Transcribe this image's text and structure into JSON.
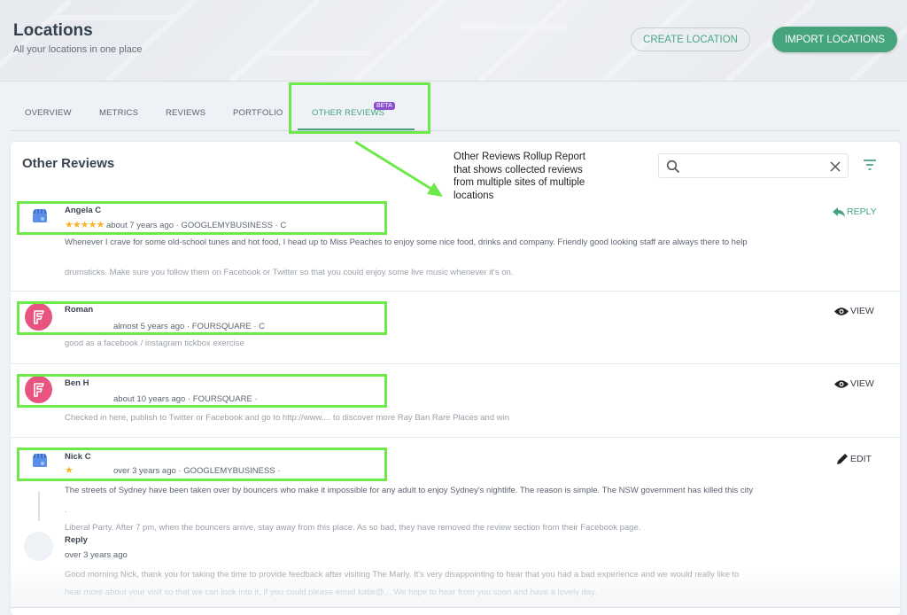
{
  "header": {
    "title": "Locations",
    "subtitle": "All your locations in one place",
    "create_button": "CREATE LOCATION",
    "import_button": "IMPORT LOCATIONS"
  },
  "tabs": [
    {
      "label": "OVERVIEW",
      "active": false
    },
    {
      "label": "METRICS",
      "active": false
    },
    {
      "label": "REVIEWS",
      "active": false
    },
    {
      "label": "PORTFOLIO",
      "active": false
    },
    {
      "label": "OTHER REVIEWS",
      "active": true,
      "badge": "BETA"
    }
  ],
  "colors": {
    "accent": "#45a47c",
    "beta_badge": "#8a4fd1",
    "star": "#f5b52b",
    "foursquare": "#e75480",
    "gmb": "#4a7fd9",
    "annotation_highlight": "#6ee94a"
  },
  "panel": {
    "title": "Other Reviews",
    "search_placeholder": "",
    "search_icon": "search-icon",
    "clear_icon": "close-icon",
    "filter_icon": "filter-icon"
  },
  "annotation": {
    "text": "Other Reviews Rollup Report that shows collected reviews from multiple sites of multiple locations"
  },
  "reviews": [
    {
      "author": "Angela C",
      "source_icon": "google-my-business-icon",
      "rating": 5,
      "stars": "★★★★★",
      "meta": "about 7 years ago · GOOGLEMYBUSINESS · C",
      "action": "REPLY",
      "action_icon": "reply-icon",
      "text_lines": [
        "Whenever I crave for some old-school tunes and hot food, I head up to Miss Peaches to enjoy some nice food, drinks and company. Friendly good looking staff are always there to help",
        "drumsticks. Make sure you follow them on Facebook or Twitter so that you could enjoy some live music whenever it's on."
      ]
    },
    {
      "author": "Roman",
      "source_icon": "foursquare-icon",
      "meta": "almost 5 years ago · FOURSQUARE · C",
      "action": "VIEW",
      "action_icon": "eye-icon",
      "text_lines": [
        "good as a facebook / instagram tickbox exercise"
      ]
    },
    {
      "author": "Ben H",
      "source_icon": "foursquare-icon",
      "meta": "about 10 years ago · FOURSQUARE ·",
      "action": "VIEW",
      "action_icon": "eye-icon",
      "text_lines": [
        "Checked in here, publish to Twitter or Facebook and go to http://www.... to discover more Ray Ban Rare Places and win"
      ]
    },
    {
      "author": "Nick C",
      "source_icon": "google-my-business-icon",
      "rating": 1,
      "stars": "★",
      "meta": "over 3 years ago · GOOGLEMYBUSINESS ·",
      "action": "EDIT",
      "action_icon": "pencil-icon",
      "text_lines": [
        "The streets of Sydney have been taken over by bouncers who make it impossible for any adult to enjoy Sydney's nightlife. The reason is simple. The NSW government has killed this city",
        ".",
        "Liberal Party. After 7 pm, when the bouncers arrive, stay away from this place. As so bad, they have removed the review section from their Facebook page."
      ],
      "reply": {
        "label": "Reply",
        "time": "over 3 years ago",
        "text_lines": [
          "Good morning Nick, thank you for taking the time to provide feedback after visiting The Marly. It's very disappointing to hear that you had a bad experience and we would really like to",
          "hear more about your visit so that we can look into it, if you could please email katie@... We hope to hear from you soon and have a lovely day."
        ]
      }
    }
  ]
}
